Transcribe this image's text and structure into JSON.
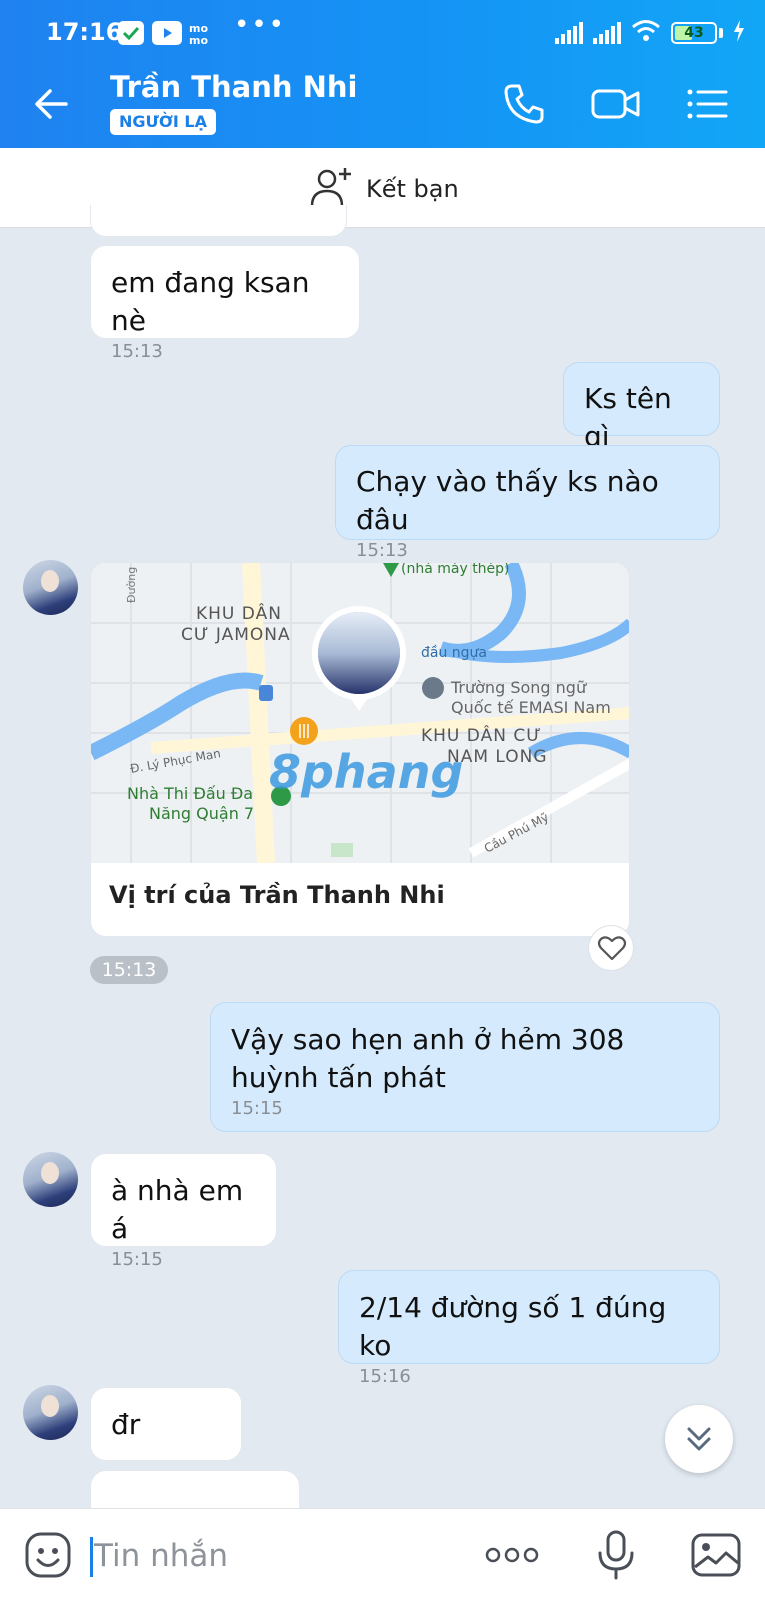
{
  "status_bar": {
    "time": "17:16",
    "dots": "•••",
    "battery": "43"
  },
  "header": {
    "contact_name": "Trần Thanh Nhi",
    "badge": "NGƯỜI LẠ",
    "icons": [
      "back-arrow-icon",
      "phone-icon",
      "video-call-icon",
      "menu-list-icon"
    ]
  },
  "friend_bar": {
    "label": "Kết bạn",
    "icon": "add-friend-icon"
  },
  "messages": [
    {
      "text": "em đang ksan nè",
      "time": "15:13",
      "direction": "in"
    },
    {
      "text": "Ks tên gì",
      "direction": "out"
    },
    {
      "text": "Chạy vào thấy ks nào đâu",
      "time": "15:13",
      "direction": "out"
    },
    {
      "text": "Vậy sao hẹn anh ở hẻm 308 huỳnh tấn phát",
      "time": "15:15",
      "direction": "out"
    },
    {
      "text": "à nhà em á",
      "time": "15:15",
      "direction": "in"
    },
    {
      "text": "2/14 đường số 1 đúng ko",
      "time": "15:16",
      "direction": "out"
    },
    {
      "text": "đr",
      "direction": "in"
    }
  ],
  "location_card": {
    "caption": "Vị trí của Trần Thanh Nhi",
    "time": "15:13",
    "map_labels": {
      "area1_line1": "KHU DÂN",
      "area1_line2": "CƯ JAMONA",
      "area2_line1": "KHU DÂN CƯ",
      "area2_line2": "NAM LONG",
      "school_line1": "Trường Song ngữ",
      "school_line2": "Quốc tế EMASI Nam",
      "arena_line1": "Nhà Thi Đấu Đa",
      "arena_line2": "Năng Quận 7",
      "street1": "Đ. Lý Phục Man",
      "street2": "Cầu Phú Mỹ",
      "street3": "Đường",
      "poi1": "(nhà máy thép)",
      "poi2": "đầu ngựa",
      "watermark": "8phang"
    }
  },
  "input_bar": {
    "placeholder": "Tin nhắn",
    "icons": [
      "sticker-icon",
      "more-options-icon",
      "microphone-icon",
      "image-icon"
    ]
  },
  "colors": {
    "header_gradient_start": "#1f82f0",
    "header_gradient_end": "#12a6f6",
    "outgoing_bubble": "#d5ebfd",
    "incoming_bubble": "#ffffff",
    "chat_background": "#e2e9f1"
  }
}
